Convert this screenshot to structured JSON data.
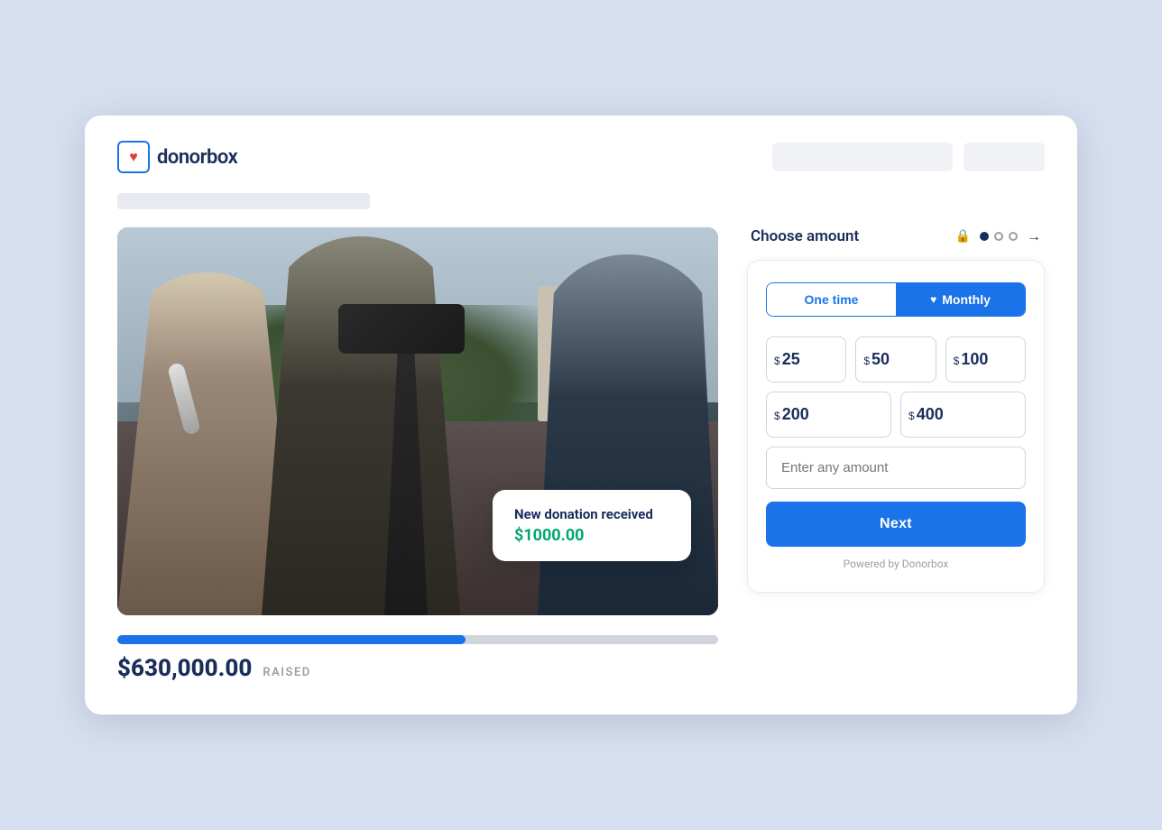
{
  "app": {
    "logo_text": "donorbox",
    "header_bar_placeholder": "",
    "header_btn_placeholder": ""
  },
  "campaign": {
    "title_placeholder": "",
    "image_alt": "News crew filming interview",
    "notification": {
      "title": "New donation received",
      "amount": "$1000.00"
    },
    "progress": {
      "raised_amount": "$630,000.00",
      "raised_label": "RAISED",
      "percent": 58
    }
  },
  "donation": {
    "section_title": "Choose amount",
    "frequency": {
      "one_time_label": "One time",
      "monthly_label": "Monthly",
      "active": "monthly"
    },
    "amounts": [
      {
        "value": "25",
        "currency": "$"
      },
      {
        "value": "50",
        "currency": "$"
      },
      {
        "value": "100",
        "currency": "$"
      },
      {
        "value": "200",
        "currency": "$"
      },
      {
        "value": "400",
        "currency": "$"
      }
    ],
    "custom_amount_placeholder": "Enter any amount",
    "next_button_label": "Next",
    "powered_by": "Powered by Donorbox"
  }
}
